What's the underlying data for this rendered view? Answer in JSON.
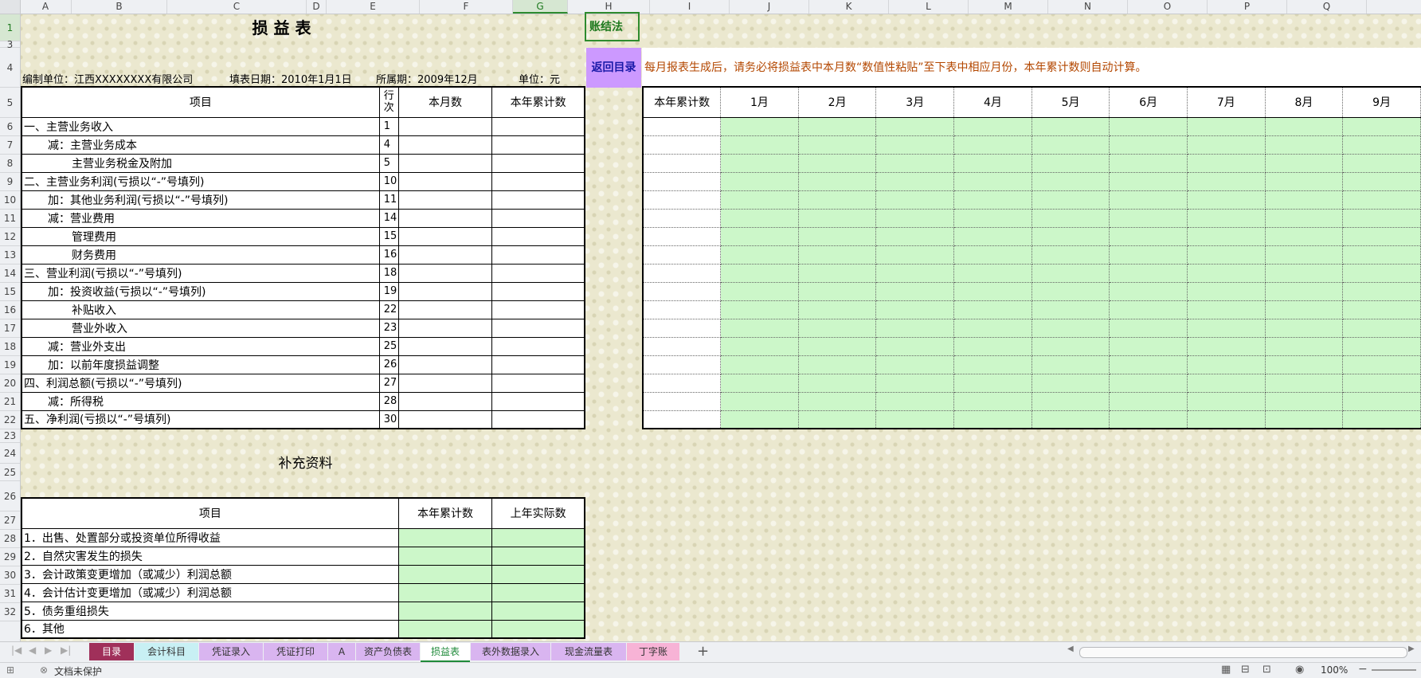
{
  "columns": [
    "A",
    "B",
    "C",
    "D",
    "E",
    "F",
    "G",
    "H",
    "I",
    "J",
    "K",
    "L",
    "M",
    "N",
    "O",
    "P",
    "Q"
  ],
  "selected_column": "G",
  "rows": [
    "1",
    "3",
    "4",
    "5",
    "6",
    "7",
    "8",
    "9",
    "10",
    "11",
    "12",
    "13",
    "14",
    "15",
    "16",
    "17",
    "18",
    "19",
    "20",
    "21",
    "22",
    "23",
    "24",
    "25",
    "26",
    "27",
    "28",
    "29",
    "30",
    "31",
    "32"
  ],
  "title": "损 益 表",
  "method_label": "账结法",
  "return_button": "返回目录",
  "info": {
    "unit_name": "编制单位：江西XXXXXXXX有限公司",
    "fill_date": "填表日期：2010年1月1日",
    "period": "所属期：2009年12月",
    "currency": "单位：元"
  },
  "notice": "每月报表生成后，请务必将损益表中本月数“数值性粘贴”至下表中相应月份，本年累计数则自动计算。",
  "main_table": {
    "headers": {
      "item": "项目",
      "line": "行次",
      "month": "本月数",
      "ytd": "本年累计数"
    },
    "rows": [
      {
        "item": "一、主营业务收入",
        "indent": 0,
        "line": "1"
      },
      {
        "item": "减：主营业务成本",
        "indent": 1,
        "line": "4"
      },
      {
        "item": "主营业务税金及附加",
        "indent": 2,
        "line": "5"
      },
      {
        "item": "二、主营业务利润(亏损以“-”号填列)",
        "indent": 0,
        "line": "10"
      },
      {
        "item": "加：其他业务利润(亏损以“-”号填列)",
        "indent": 1,
        "line": "11"
      },
      {
        "item": "减：营业费用",
        "indent": 1,
        "line": "14"
      },
      {
        "item": "管理费用",
        "indent": 2,
        "line": "15"
      },
      {
        "item": "财务费用",
        "indent": 2,
        "line": "16"
      },
      {
        "item": "三、营业利润(亏损以“-”号填列)",
        "indent": 0,
        "line": "18"
      },
      {
        "item": "加：投资收益(亏损以“-”号填列)",
        "indent": 1,
        "line": "19"
      },
      {
        "item": "补贴收入",
        "indent": 2,
        "line": "22"
      },
      {
        "item": "营业外收入",
        "indent": 2,
        "line": "23"
      },
      {
        "item": "减：营业外支出",
        "indent": 1,
        "line": "25"
      },
      {
        "item": "加：以前年度损益调整",
        "indent": 1,
        "line": "26"
      },
      {
        "item": "四、利润总额(亏损以“-”号填列)",
        "indent": 0,
        "line": "27"
      },
      {
        "item": "减：所得税",
        "indent": 1,
        "line": "28"
      },
      {
        "item": "五、净利润(亏损以“-”号填列)",
        "indent": 0,
        "line": "30"
      }
    ]
  },
  "monthly_table": {
    "headers": [
      "本年累计数",
      "1月",
      "2月",
      "3月",
      "4月",
      "5月",
      "6月",
      "7月",
      "8月",
      "9月"
    ]
  },
  "supplement": {
    "title": "补充资料",
    "headers": {
      "item": "项目",
      "ytd": "本年累计数",
      "last_year": "上年实际数"
    },
    "rows": [
      "1．出售、处置部分或投资单位所得收益",
      "2．自然灾害发生的损失",
      "3．会计政策变更增加（或减少）利润总额",
      "4．会计估计变更增加（或减少）利润总额",
      "5．债务重组损失",
      "6．其他"
    ]
  },
  "sheet_tabs": [
    {
      "label": "目录",
      "bg": "#a0305a",
      "fg": "#ffffff"
    },
    {
      "label": "会计科目",
      "bg": "#c8f0f4",
      "fg": "#333333"
    },
    {
      "label": "凭证录入",
      "bg": "#d9b5f0",
      "fg": "#333333"
    },
    {
      "label": "凭证打印",
      "bg": "#d9b5f0",
      "fg": "#333333"
    },
    {
      "label": "A",
      "bg": "#d9b5f0",
      "fg": "#333333"
    },
    {
      "label": "资产负债表",
      "bg": "#d9b5f0",
      "fg": "#333333"
    },
    {
      "label": "损益表",
      "bg": "#ffffff",
      "fg": "#1f8a3a"
    },
    {
      "label": "表外数据录入",
      "bg": "#d9b5f0",
      "fg": "#333333"
    },
    {
      "label": "现金流量表",
      "bg": "#d9b5f0",
      "fg": "#333333"
    },
    {
      "label": "丁字账",
      "bg": "#f7b3d6",
      "fg": "#333333"
    }
  ],
  "status": {
    "protect": "文档未保护",
    "zoom": "100%"
  },
  "colors": {
    "green_fill": "#ccf7c9",
    "purple_button": "#cc99ff",
    "notice_text": "#b34700",
    "method_text": "#1f7a1f"
  }
}
